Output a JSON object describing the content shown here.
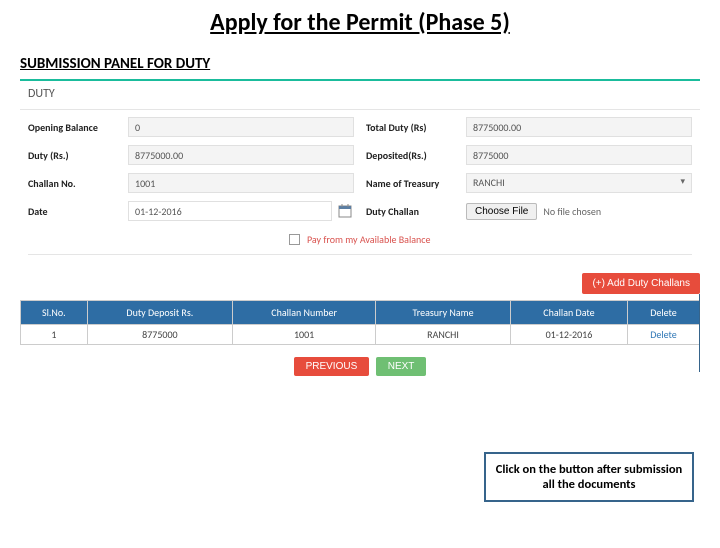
{
  "title": "Apply for the Permit (Phase 5)",
  "subtitle": "SUBMISSION PANEL FOR DUTY",
  "panelHeader": "DUTY",
  "left": {
    "openingBalance": {
      "label": "Opening Balance",
      "value": "0"
    },
    "dutyRs": {
      "label": "Duty (Rs.)",
      "value": "8775000.00"
    },
    "challanNo": {
      "label": "Challan No.",
      "value": "1001"
    },
    "date": {
      "label": "Date",
      "value": "01-12-2016"
    }
  },
  "right": {
    "totalDuty": {
      "label": "Total Duty (Rs)",
      "value": "8775000.00"
    },
    "deposited": {
      "label": "Deposited(Rs.)",
      "value": "8775000"
    },
    "treasury": {
      "label": "Name of Treasury",
      "value": "RANCHI"
    },
    "dutyChallan": {
      "label": "Duty Challan",
      "choose": "Choose File",
      "fileStatus": "No file chosen"
    }
  },
  "payFromBalance": "Pay from my Available Balance",
  "addButton": "(+) Add Duty Challans",
  "table": {
    "headers": [
      "Sl.No.",
      "Duty Deposit Rs.",
      "Challan Number",
      "Treasury Name",
      "Challan Date",
      "Delete"
    ],
    "rows": [
      {
        "sl": "1",
        "deposit": "8775000",
        "challan": "1001",
        "treasury": "RANCHI",
        "date": "01-12-2016",
        "delete": "Delete"
      }
    ]
  },
  "prevBtn": "PREVIOUS",
  "nextBtn": "NEXT",
  "callout": "Click on the button after submission all the documents"
}
